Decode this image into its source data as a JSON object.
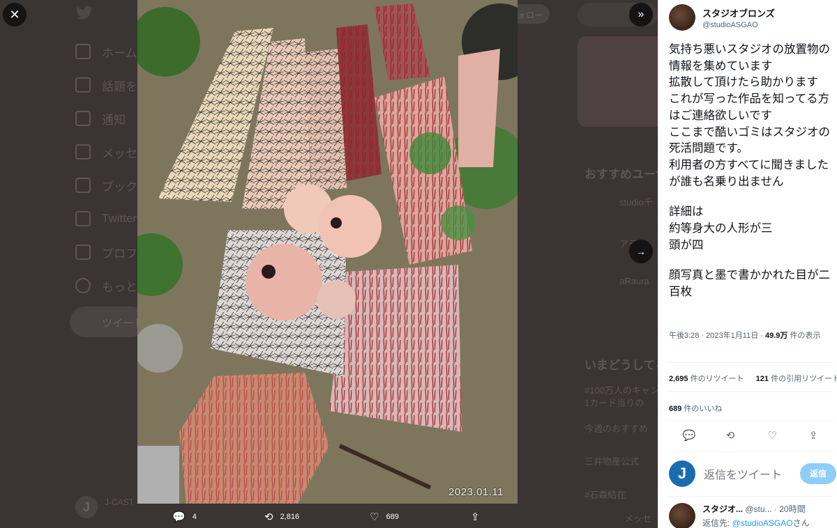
{
  "background": {
    "nav_items": [
      "ホーム",
      "話題を検索",
      "通知",
      "メッセージ",
      "ブックマーク",
      "Twitter Blue",
      "プロフィール",
      "もっと見る"
    ],
    "tweet_button_label": "ツイート",
    "account_name": "J-CAST",
    "account_avatar_letter": "J",
    "follow_label": "フォロー",
    "side_recommend_title": "おすすめユーザー",
    "side_trends_title": "いまどうしてる？",
    "side_items": [
      "studio千",
      "アラ",
      "aRaura",
      "#100万人のキャン",
      "1カード当りの",
      "今週のおすすめ",
      "三井物産公式",
      "#石森結在",
      "メッセ"
    ]
  },
  "media": {
    "close_icon": "close-icon",
    "expand_icon": "chevrons-right-icon",
    "next_icon": "arrow-right-icon",
    "photo_date": "2023.01.11",
    "actions": [
      {
        "icon": "reply-icon",
        "count": "4"
      },
      {
        "icon": "retweet-icon",
        "count": "2,816"
      },
      {
        "icon": "like-icon",
        "count": "689"
      },
      {
        "icon": "share-icon",
        "count": ""
      }
    ]
  },
  "tweet": {
    "author_name": "スタジオブロンズ",
    "author_handle": "@studioASGAO",
    "text_part1": "気持ち悪いスタジオの放置物の情報を集めています\n拡散して頂けたら助かります\nこれが写った作品を知ってる方はご連絡欲しいです\nここまで酷いゴミはスタジオの死活問題です。\n利用者の方すべてに聞きましたが誰も名乗り出ません",
    "text_part2": "詳細は\n約等身大の人形が三\n頭が四",
    "text_part3": "顔写真と墨で書かかれた目が二百枚",
    "timestamp": "午後3:28 · 2023年1月11日 · ",
    "views_count": "49.9万",
    "views_label": " 件の表示",
    "retweets_count": "2,695",
    "retweets_label": " 件のリツイート",
    "quotes_count": "121",
    "quotes_label": " 件の引用リツイート",
    "likes_count": "689",
    "likes_label": " 件のいいね",
    "reply_placeholder": "返信をツイート",
    "reply_button": "返信",
    "reply_avatar_letter": "J"
  },
  "reply": {
    "name": "スタジオ...",
    "handle": "@stu...",
    "time": "· 20時間",
    "replying_to_label": "返信先: ",
    "replying_to_handle": "@studioASGAO",
    "replying_to_suffix": "さん"
  }
}
